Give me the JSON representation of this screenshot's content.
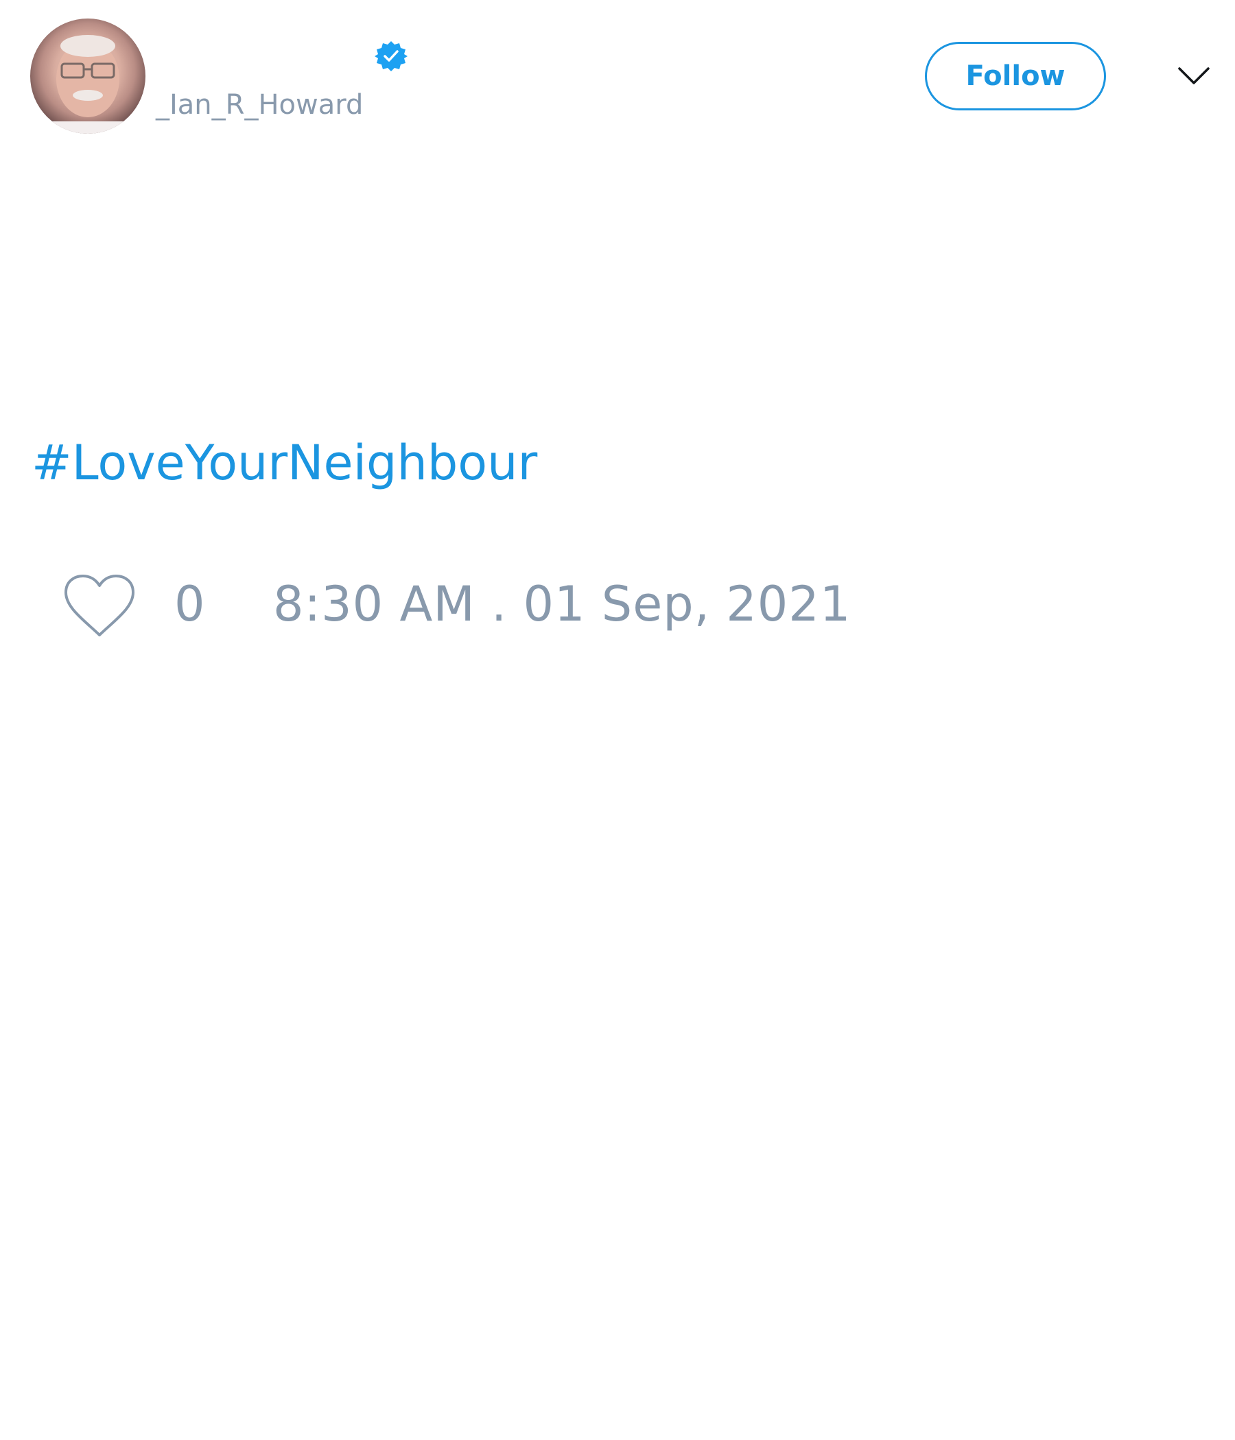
{
  "author": {
    "display_name": "",
    "handle": "_Ian_R_Howard",
    "verified": true
  },
  "header": {
    "follow_label": "Follow",
    "menu_icon": "chevron-down-icon"
  },
  "tweet": {
    "text": "#LoveYourNeighbour"
  },
  "footer": {
    "like_icon": "heart-icon",
    "like_count": "0",
    "timestamp": "8:30 AM . 01 Sep, 2021"
  },
  "colors": {
    "accent": "#1b95e0",
    "muted": "#8899ac",
    "verified": "#1da1f2"
  }
}
